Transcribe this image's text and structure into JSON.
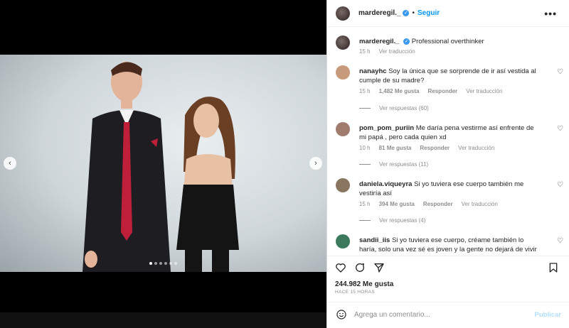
{
  "post": {
    "author": "marderegil._",
    "follow_label": "Seguir",
    "separator": "•",
    "more_label": "•••",
    "caption": "Professional overthinker",
    "caption_time": "15 h",
    "caption_translate": "Ver traducción"
  },
  "comments": [
    {
      "user": "nanayhc",
      "text": "Soy la única que se sorprende de ir así vestida al cumple de su madre?",
      "time": "15 h",
      "likes": "1,482 Me gusta",
      "reply": "Responder",
      "translate": "Ver traducción",
      "replies": "Ver respuestas (60)",
      "avatar_color": "#c79a7c"
    },
    {
      "user": "pom_pom_puriin",
      "text": "Me daría pena vestirme así enfrente de mi papá , pero cada quien xd",
      "time": "10 h",
      "likes": "81 Me gusta",
      "reply": "Responder",
      "translate": "Ver traducción",
      "replies": "Ver respuestas (11)",
      "avatar_color": "#a07c6e"
    },
    {
      "user": "daniela.viqueyra",
      "text": "Si yo tuviera ese cuerpo también me vestiría así",
      "time": "15 h",
      "likes": "394 Me gusta",
      "reply": "Responder",
      "translate": "Ver traducción",
      "replies": "Ver respuestas (4)",
      "avatar_color": "#8a7560"
    },
    {
      "user": "sandii_iis",
      "text": "Si yo tuviera ese cuerpo, créame también lo haría, solo una vez sé es joven y la gente no dejará de vivir por uno.",
      "avatar_color": "#3c7a5c"
    }
  ],
  "stats": {
    "likes": "244.982 Me gusta",
    "ago": "HACE 15 HORAS"
  },
  "composer": {
    "placeholder": "Agrega un comentario...",
    "publish": "Publicar"
  },
  "carousel": {
    "prev_icon": "chevron-left-icon",
    "next_icon": "chevron-right-icon",
    "current": 1,
    "total": 6
  },
  "colors": {
    "link": "#0095f6",
    "verified": "#3897f0",
    "muted": "#8e8e8e",
    "text": "#262626"
  }
}
